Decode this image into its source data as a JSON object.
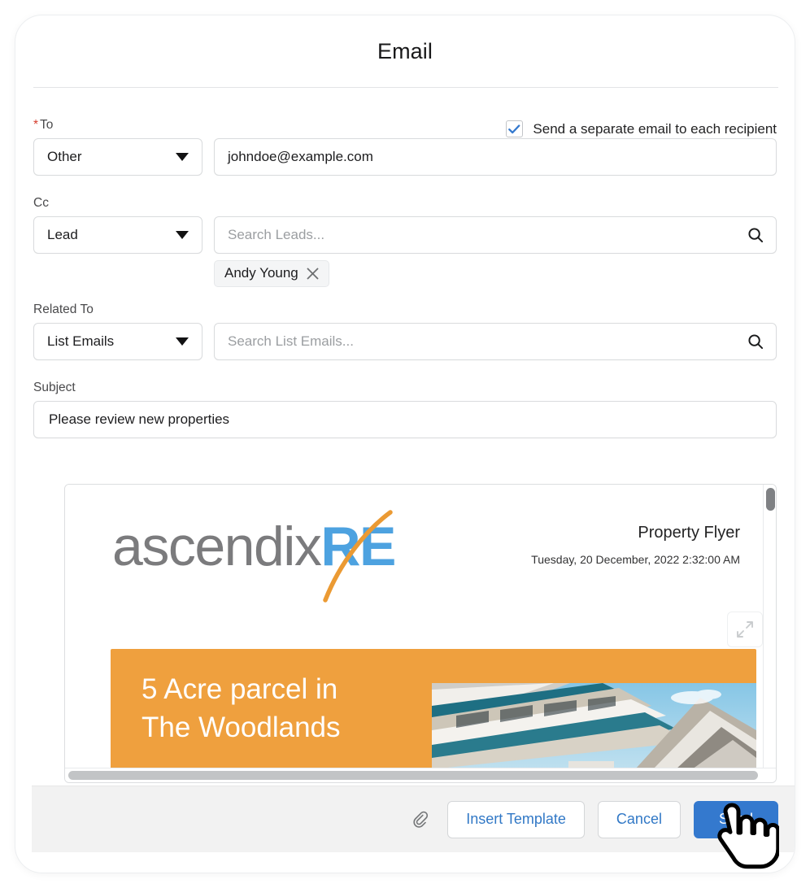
{
  "modal": {
    "title": "Email"
  },
  "form": {
    "to": {
      "label": "To",
      "required_marker": "*",
      "type_value": "Other",
      "recipient_value": "johndoe@example.com"
    },
    "separate_email": {
      "label": "Send a separate email to each recipient",
      "checked": true
    },
    "cc": {
      "label": "Cc",
      "type_value": "Lead",
      "search_placeholder": "Search Leads...",
      "chips": [
        {
          "label": "Andy Young",
          "remove_label": "×"
        }
      ]
    },
    "related_to": {
      "label": "Related To",
      "type_value": "List Emails",
      "search_placeholder": "Search List Emails..."
    },
    "subject": {
      "label": "Subject",
      "value": "Please review new properties"
    }
  },
  "preview": {
    "logo": {
      "part_gray": "ascendi",
      "part_x": "x",
      "part_blue": "RE"
    },
    "flyer_title": "Property Flyer",
    "flyer_date": "Tuesday, 20 December, 2022 2:32:00 AM",
    "banner_line1": "5 Acre parcel in",
    "banner_line2": "The Woodlands"
  },
  "footer": {
    "attach_icon": "paperclip-icon",
    "insert_template_label": "Insert Template",
    "cancel_label": "Cancel",
    "send_label": "Send"
  },
  "colors": {
    "primary_blue": "#3479ce",
    "link_blue": "#3178c6",
    "brand_orange": "#efa03e",
    "logo_blue": "#4da2e0",
    "logo_gray": "#7b7b7d",
    "required_red": "#d63d2e",
    "footer_bg": "#f2f2f2"
  }
}
